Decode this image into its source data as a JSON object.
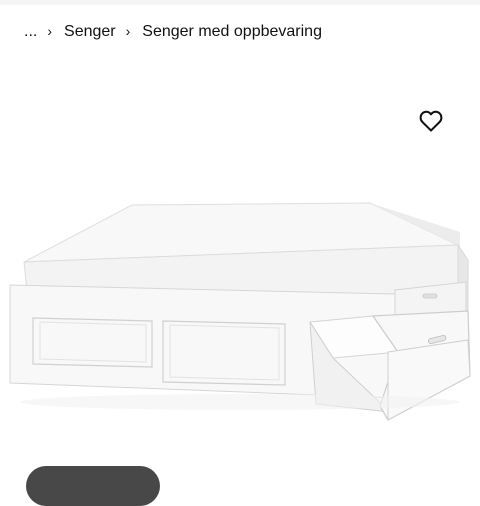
{
  "breadcrumb": {
    "ellipsis": "...",
    "items": [
      {
        "label": "Senger"
      },
      {
        "label": "Senger med oppbevaring"
      }
    ]
  },
  "icons": {
    "separator": "chevron-right-icon",
    "favorite": "heart-outline-icon"
  },
  "colors": {
    "text": "#111111",
    "bed_white": "#f7f7f7",
    "pill": "#484848"
  }
}
